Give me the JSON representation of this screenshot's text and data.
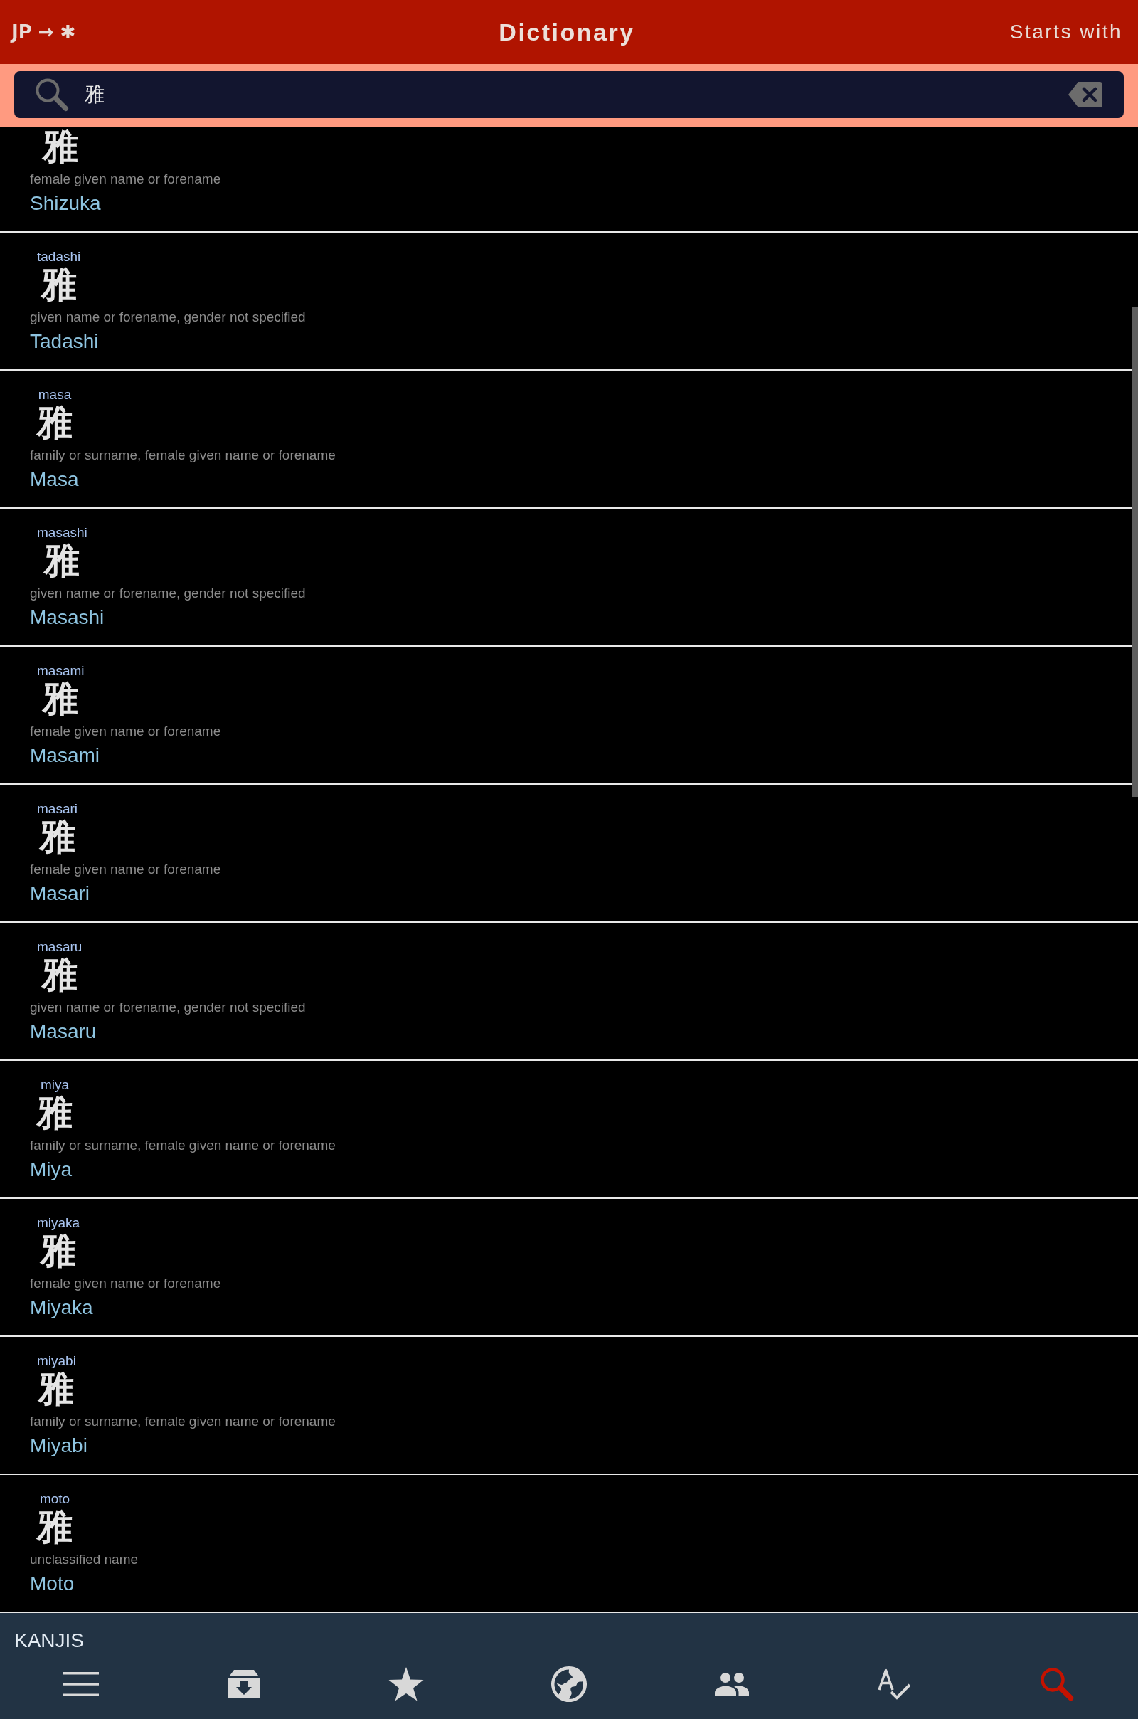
{
  "header": {
    "direction": "JP → ✱",
    "title": "Dictionary",
    "mode": "Starts with"
  },
  "search": {
    "value": "雅"
  },
  "results": [
    {
      "kanji": "雅",
      "meaning": "female given name or forename",
      "name": "Shizuka"
    },
    {
      "reading": "tadashi",
      "kanji": "雅",
      "meaning": "given name or forename, gender not specified",
      "name": "Tadashi"
    },
    {
      "reading": "masa",
      "kanji": "雅",
      "meaning": "family or surname, female given name or forename",
      "name": "Masa"
    },
    {
      "reading": "masashi",
      "kanji": "雅",
      "meaning": "given name or forename, gender not specified",
      "name": "Masashi"
    },
    {
      "reading": "masami",
      "kanji": "雅",
      "meaning": "female given name or forename",
      "name": "Masami"
    },
    {
      "reading": "masari",
      "kanji": "雅",
      "meaning": "female given name or forename",
      "name": "Masari"
    },
    {
      "reading": "masaru",
      "kanji": "雅",
      "meaning": "given name or forename, gender not specified",
      "name": "Masaru"
    },
    {
      "reading": "miya",
      "kanji": "雅",
      "meaning": "family or surname, female given name or forename",
      "name": "Miya"
    },
    {
      "reading": "miyaka",
      "kanji": "雅",
      "meaning": "female given name or forename",
      "name": "Miyaka"
    },
    {
      "reading": "miyabi",
      "kanji": "雅",
      "meaning": "family or surname, female given name or forename",
      "name": "Miyabi"
    },
    {
      "reading": "moto",
      "kanji": "雅",
      "meaning": "unclassified name",
      "name": "Moto"
    }
  ],
  "kanji_panel": {
    "title": "KANJIS"
  },
  "toolbar": [
    {
      "selected": false
    },
    {
      "selected": false
    },
    {
      "selected": false
    },
    {
      "selected": false
    },
    {
      "selected": false
    },
    {
      "selected": false
    },
    {
      "selected": true
    }
  ]
}
